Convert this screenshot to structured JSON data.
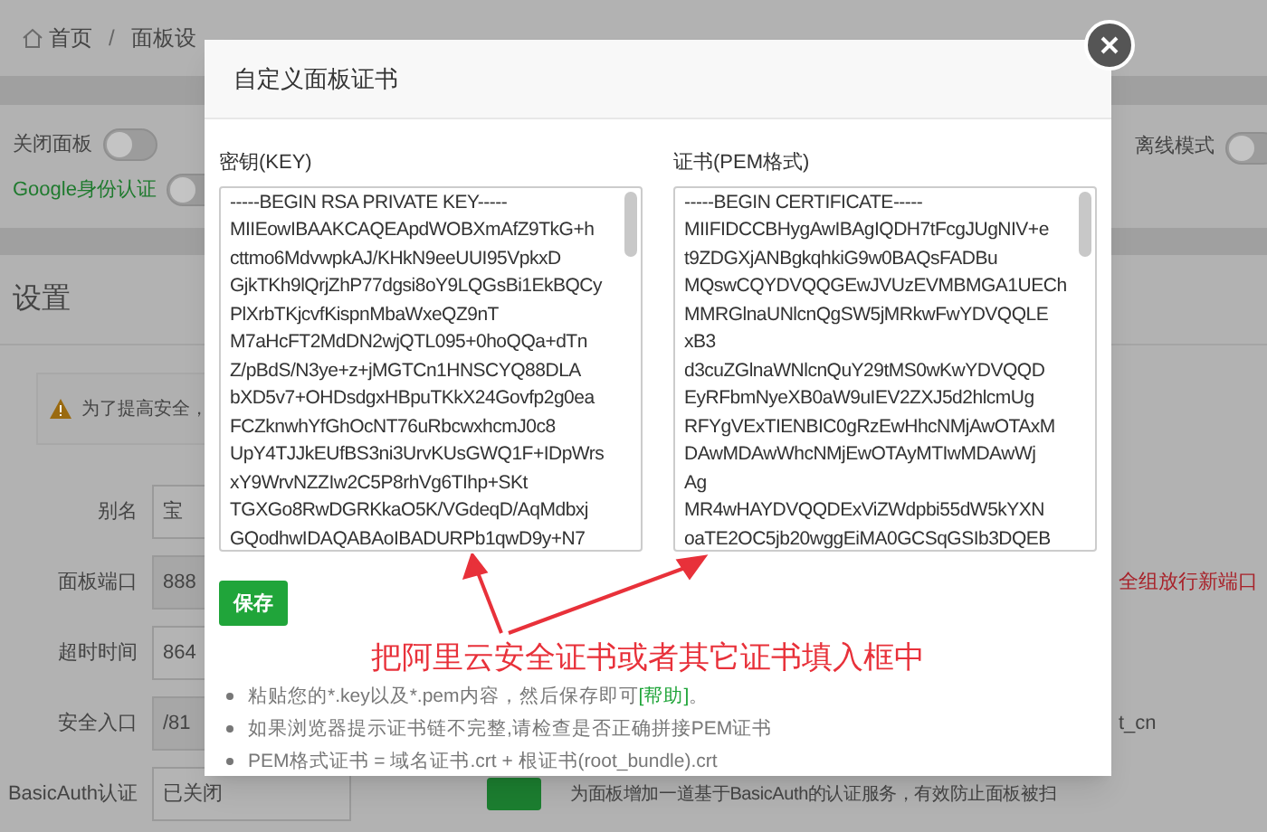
{
  "breadcrumb": {
    "home": "首页",
    "separator": "/",
    "current": "面板设"
  },
  "left_switches": [
    {
      "label": "关闭面板",
      "on": false,
      "kind": "plain"
    },
    {
      "label": "Google身份认证",
      "on": false,
      "kind": "highlighted"
    }
  ],
  "right_switch": {
    "label": "离线模式",
    "on": false
  },
  "settings": {
    "title": "设置",
    "warning": "为了提高安全，",
    "fields": [
      {
        "label": "别名",
        "value": "宝",
        "disabled": false
      },
      {
        "label": "面板端口",
        "value": "888",
        "disabled": true
      },
      {
        "label": "超时时间",
        "value": "864",
        "disabled": false
      },
      {
        "label": "安全入口",
        "value": "/81",
        "disabled": true
      },
      {
        "label": "BasicAuth认证",
        "value": "已关闭",
        "disabled": false
      }
    ],
    "port_note": "全组放行新端口",
    "entry_note": "t_cn",
    "basic_auth_hint": "为面板增加一道基于BasicAuth的认证服务，有效防止面板被扫"
  },
  "dialog": {
    "title": "自定义面板证书",
    "key": {
      "label": "密钥(KEY)",
      "lines": [
        "-----BEGIN RSA PRIVATE KEY-----",
        "MIIEowIBAAKCAQEApdWOBXmAfZ9TkG+h",
        "cttmo6MdvwpkAJ/KHkN9eeUUI95VpkxD",
        "GjkTKh9lQrjZhP77dgsi8oY9LQGsBi1EkBQCy",
        "PlXrbTKjcvfKispnMbaWxeQZ9nT",
        "M7aHcFT2MdDN2wjQTL095+0hoQQa+dTn",
        "Z/pBdS/N3ye+z+jMGTCn1HNSCYQ88DLA",
        "bXD5v7+OHDsdgxHBpuTKkX24Govfp2g0ea",
        "FCZknwhYfGhOcNT76uRbcwxhcmJ0c8",
        "UpY4TJJkEUfBS3ni3UrvKUsGWQ1F+IDpWrs",
        "xY9WrvNZZIw2C5P8rhVg6TIhp+SKt",
        "TGXGo8RwDGRKkaO5K/VGdeqD/AqMdbxj",
        "GQodhwIDAQABAoIBADURPb1qwD9y+N7"
      ]
    },
    "cert": {
      "label": "证书(PEM格式)",
      "lines": [
        "-----BEGIN CERTIFICATE-----",
        "MIIFIDCCBHygAwIBAgIQDH7tFcgJUgNIV+e",
        "t9ZDGXjANBgkqhkiG9w0BAQsFADBu",
        "MQswCQYDVQQGEwJVUzEVMBMGA1UECh",
        "MMRGlnaUNlcnQgSW5jMRkwFwYDVQQLE",
        "xB3",
        "d3cuZGlnaWNlcnQuY29tMS0wKwYDVQQD",
        "EyRFbmNyeXB0aW9uIEV2ZXJ5d2hlcmUg",
        "RFYgVExTIENBIC0gRzEwHhcNMjAwOTAxM",
        "DAwMDAwWhcNMjEwOTAyMTIwMDAwWj",
        "Ag",
        "MR4wHAYDVQQDExViZWdpbi55dW5kYXN",
        "oaTE2OC5jb20wggEiMA0GCSqGSIb3DQEB"
      ]
    },
    "save_button": "保存",
    "annotation": "把阿里云安全证书或者其它证书填入框中",
    "tips": [
      {
        "text": "粘贴您的*.key以及*.pem内容，然后保存即可",
        "link": "[帮助]",
        "after": "。"
      },
      {
        "text": "如果浏览器提示证书链不完整,请检查是否正确拼接PEM证书"
      },
      {
        "text": "PEM格式证书 = 域名证书.crt + 根证书(root_bundle).crt"
      }
    ]
  }
}
